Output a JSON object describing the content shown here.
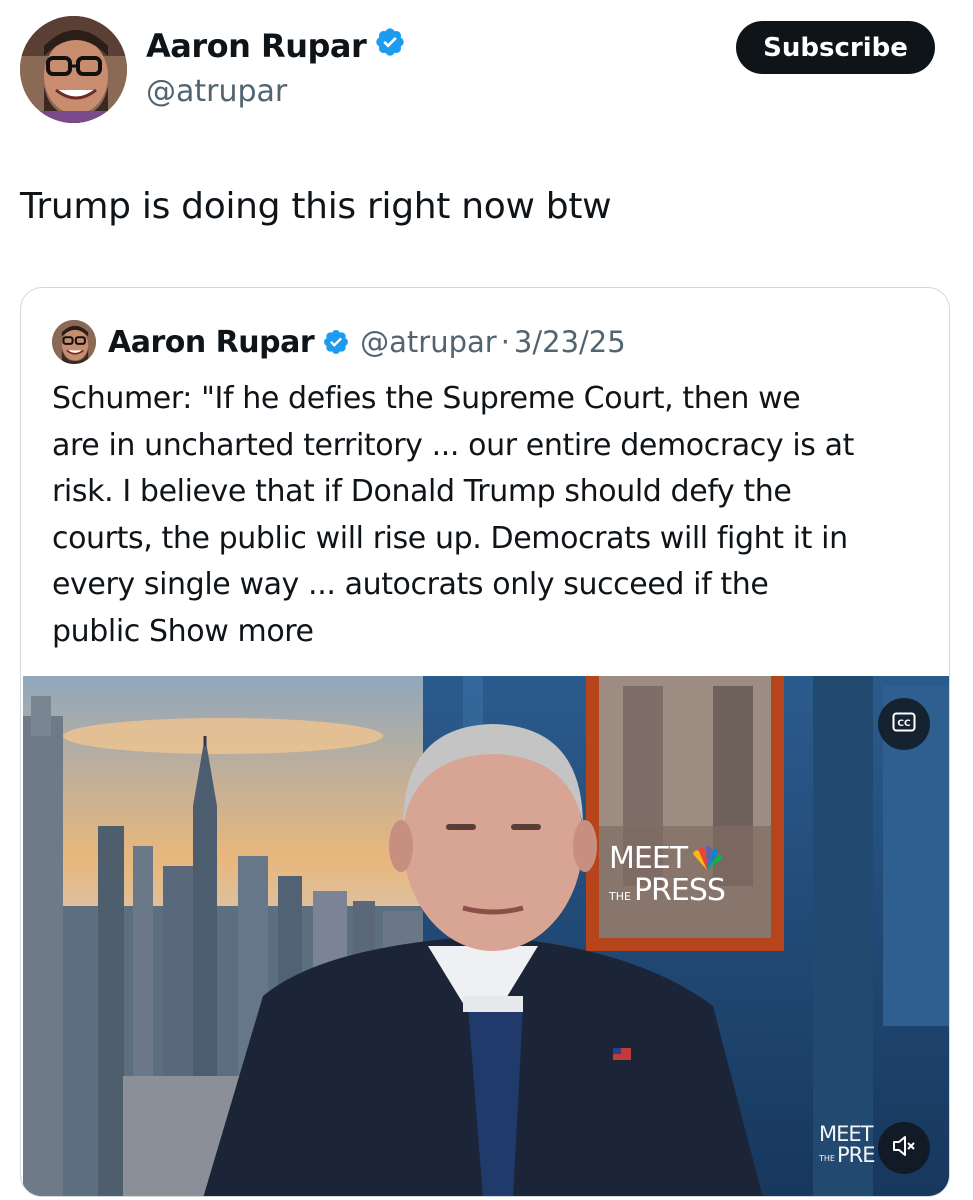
{
  "tweet": {
    "author_name": "Aaron Rupar",
    "author_handle": "@atrupar",
    "subscribe_label": "Subscribe",
    "text": "Trump is doing this right now btw"
  },
  "quoted_tweet": {
    "author_name": "Aaron Rupar",
    "author_handle": "@atrupar",
    "separator": "·",
    "date": "3/23/25",
    "text_lines": [
      "Schumer: \"If he defies the Supreme Court, then we",
      "are in uncharted territory ... our entire democracy is at",
      "risk. I believe that if Donald Trump should defy the",
      "courts, the public will rise up. Democrats will fight it in",
      "every single way ... autocrats only succeed if the",
      "public"
    ],
    "show_more_label": "Show more"
  },
  "video": {
    "logo_line1": "MEET",
    "logo_line2_small": "THE",
    "logo_line2": "PRESS",
    "corner_logo_line1": "MEET",
    "corner_logo_small": "THE",
    "corner_logo_line2": "PRE",
    "cc_icon": "closed-captions-icon",
    "mute_icon": "volume-muted-icon"
  },
  "colors": {
    "verified_blue": "#1d9bf0",
    "secondary_text": "#536471",
    "button_dark": "#0f1419",
    "border": "#cfd9de",
    "peacock": [
      "#f8b912",
      "#ef4136",
      "#6460aa",
      "#0089d0",
      "#0db14b",
      "#fcb711"
    ]
  }
}
